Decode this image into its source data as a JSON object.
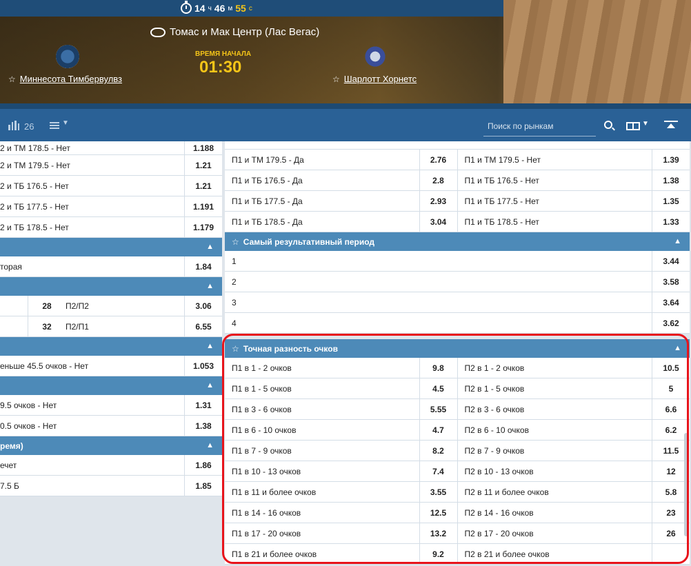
{
  "header": {
    "timer": {
      "hours": "14",
      "h_unit": "ч",
      "minutes": "46",
      "m_unit": "м",
      "seconds": "55",
      "s_unit": "с"
    },
    "venue": "Томас и Мак Центр (Лас Вегас)",
    "start_label": "ВРЕМЯ НАЧАЛА",
    "start_time": "01:30",
    "team_home": "Миннесота Тимбервулвз",
    "team_away": "Шарлотт Хорнетс"
  },
  "toolbar": {
    "market_count": "26",
    "search_placeholder": "Поиск по рынкам"
  },
  "left": {
    "rows_top": [
      {
        "name": "2 и ТМ 178.5 - Нет",
        "odds": "1.188"
      },
      {
        "name": "2 и ТМ 179.5 - Нет",
        "odds": "1.21"
      },
      {
        "name": "2 и ТБ 176.5 - Нет",
        "odds": "1.21"
      },
      {
        "name": "2 и ТБ 177.5 - Нет",
        "odds": "1.191"
      },
      {
        "name": "2 и ТБ 178.5 - Нет",
        "odds": "1.179"
      }
    ],
    "sec2_row": {
      "name": "торая",
      "odds": "1.84"
    },
    "sec3_rows": [
      {
        "v1": "28",
        "name": "П2/П2",
        "odds": "3.06"
      },
      {
        "v1": "32",
        "name": "П2/П1",
        "odds": "6.55"
      }
    ],
    "sec4_row": {
      "name": "еньше 45.5 очков - Нет",
      "odds": "1.053"
    },
    "sec5_rows": [
      {
        "name": "9.5 очков - Нет",
        "odds": "1.31"
      },
      {
        "name": "0.5 очков - Нет",
        "odds": "1.38"
      }
    ],
    "sec6_title": "ремя)",
    "sec6_rows": [
      {
        "name": "ечет",
        "odds": "1.86"
      },
      {
        "name": "7.5 Б",
        "odds": "1.85"
      }
    ]
  },
  "right": {
    "rows_top": [
      {
        "l": "П1 и ТМ 179.5 - Да",
        "lo": "2.76",
        "r": "П1 и ТМ 179.5 - Нет",
        "ro": "1.39"
      },
      {
        "l": "П1 и ТБ 176.5 - Да",
        "lo": "2.8",
        "r": "П1 и ТБ 176.5 - Нет",
        "ro": "1.38"
      },
      {
        "l": "П1 и ТБ 177.5 - Да",
        "lo": "2.93",
        "r": "П1 и ТБ 177.5 - Нет",
        "ro": "1.35"
      },
      {
        "l": "П1 и ТБ 178.5 - Да",
        "lo": "3.04",
        "r": "П1 и ТБ 178.5 - Нет",
        "ro": "1.33"
      }
    ],
    "period_title": "Самый результативный период",
    "period_rows": [
      {
        "name": "1",
        "odds": "3.44"
      },
      {
        "name": "2",
        "odds": "3.58"
      },
      {
        "name": "3",
        "odds": "3.64"
      },
      {
        "name": "4",
        "odds": "3.62"
      }
    ],
    "diff_title": "Точная разность очков",
    "diff_rows": [
      {
        "l": "П1 в 1 - 2 очков",
        "lo": "9.8",
        "r": "П2 в 1 - 2 очков",
        "ro": "10.5"
      },
      {
        "l": "П1 в 1 - 5 очков",
        "lo": "4.5",
        "r": "П2 в 1 - 5 очков",
        "ro": "5"
      },
      {
        "l": "П1 в 3 - 6 очков",
        "lo": "5.55",
        "r": "П2 в 3 - 6 очков",
        "ro": "6.6"
      },
      {
        "l": "П1 в 6 - 10 очков",
        "lo": "4.7",
        "r": "П2 в 6 - 10 очков",
        "ro": "6.2"
      },
      {
        "l": "П1 в 7 - 9 очков",
        "lo": "8.2",
        "r": "П2 в 7 - 9 очков",
        "ro": "11.5"
      },
      {
        "l": "П1 в 10 - 13 очков",
        "lo": "7.4",
        "r": "П2 в 10 - 13 очков",
        "ro": "12"
      },
      {
        "l": "П1 в 11 и более очков",
        "lo": "3.55",
        "r": "П2 в 11 и более очков",
        "ro": "5.8"
      },
      {
        "l": "П1 в 14 - 16 очков",
        "lo": "12.5",
        "r": "П2 в 14 - 16 очков",
        "ro": "23"
      },
      {
        "l": "П1 в 17 - 20 очков",
        "lo": "13.2",
        "r": "П2 в 17 - 20 очков",
        "ro": "26"
      },
      {
        "l": "П1 в 21 и более очков",
        "lo": "9.2",
        "r": "П2 в 21 и более очков",
        "ro": ""
      }
    ]
  },
  "colors": {
    "header_blue": "#2a6196",
    "section_blue": "#4d8ab8",
    "accent_yellow": "#f5c518",
    "highlight_red": "#e8141b"
  }
}
